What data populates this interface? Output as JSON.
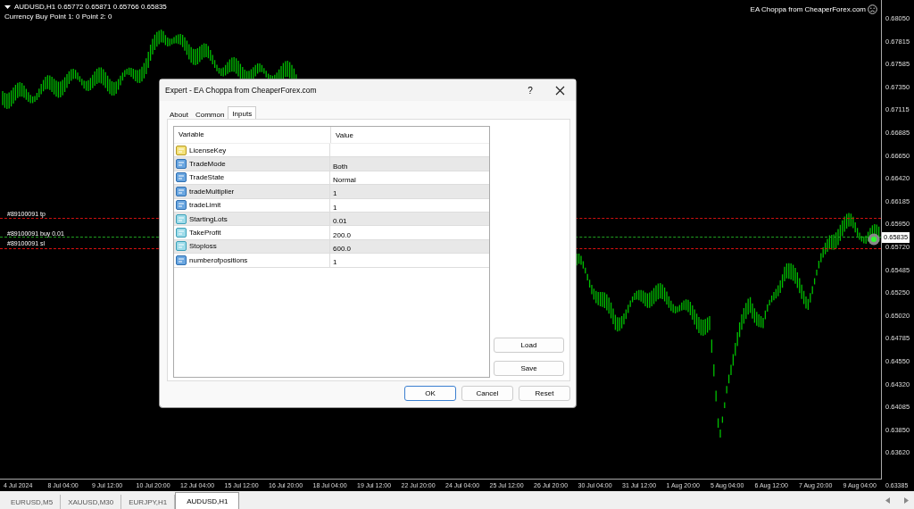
{
  "chart_header": {
    "symbol_line": "AUDUSD,H1  0.65772 0.65871 0.65766 0.65835",
    "info_line": "Currency Buy Point 1: 0 Point 2: 0"
  },
  "expert_label": "EA Choppa from CheaperForex.com",
  "trade_lines": [
    {
      "kind": "tp",
      "label": "#89100091 tp"
    },
    {
      "kind": "buy",
      "label": "#89100091 buy 0.01"
    },
    {
      "kind": "sl",
      "label": "#89100091 sl"
    }
  ],
  "price_axis": [
    "0.68050",
    "0.67815",
    "0.67585",
    "0.67350",
    "0.67115",
    "0.66885",
    "0.66650",
    "0.66420",
    "0.66185",
    "0.65950",
    "0.65720",
    "0.65485",
    "0.65250",
    "0.65020",
    "0.64785",
    "0.64550",
    "0.64320",
    "0.64085",
    "0.63850",
    "0.63620"
  ],
  "current_price": "0.65835",
  "axis_bottom_price": "0.63385",
  "time_axis": [
    "4 Jul 2024",
    "8 Jul 04:00",
    "9 Jul 12:00",
    "10 Jul 20:00",
    "12 Jul 04:00",
    "15 Jul 12:00",
    "16 Jul 20:00",
    "18 Jul 04:00",
    "19 Jul 12:00",
    "22 Jul 20:00",
    "24 Jul 04:00",
    "25 Jul 12:00",
    "26 Jul 20:00",
    "30 Jul 04:00",
    "31 Jul 12:00",
    "1 Aug 20:00",
    "5 Aug 04:00",
    "6 Aug 12:00",
    "7 Aug 20:00",
    "9 Aug 04:00"
  ],
  "chart_tabs": [
    {
      "label": "EURUSD,M5",
      "selected": false
    },
    {
      "label": "XAUUSD,M30",
      "selected": false
    },
    {
      "label": "EURJPY,H1",
      "selected": false
    },
    {
      "label": "AUDUSD,H1",
      "selected": true
    }
  ],
  "dialog": {
    "title": "Expert - EA Choppa from CheaperForex.com",
    "help": "?",
    "tabs": [
      {
        "label": "About",
        "selected": false
      },
      {
        "label": "Common",
        "selected": false
      },
      {
        "label": "Inputs",
        "selected": true
      }
    ],
    "columns": [
      "Variable",
      "Value"
    ],
    "rows": [
      {
        "kind": "string",
        "variable": "LicenseKey",
        "value": ""
      },
      {
        "kind": "int",
        "variable": "TradeMode",
        "value": "Both"
      },
      {
        "kind": "int",
        "variable": "TradeState",
        "value": "Normal"
      },
      {
        "kind": "int",
        "variable": "tradeMultiplier",
        "value": "1"
      },
      {
        "kind": "int",
        "variable": "tradeLimit",
        "value": "1"
      },
      {
        "kind": "double",
        "variable": "StartingLots",
        "value": "0.01"
      },
      {
        "kind": "double",
        "variable": "TakeProfit",
        "value": "200.0"
      },
      {
        "kind": "double",
        "variable": "Stoploss",
        "value": "600.0"
      },
      {
        "kind": "int",
        "variable": "numberofpositions",
        "value": "1"
      }
    ],
    "side_buttons": [
      "Load",
      "Save"
    ],
    "footer_buttons": [
      {
        "label": "OK",
        "default": true
      },
      {
        "label": "Cancel",
        "default": false
      },
      {
        "label": "Reset",
        "default": false
      }
    ]
  }
}
